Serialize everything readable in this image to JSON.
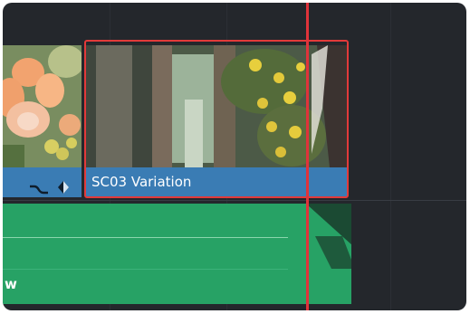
{
  "timeline": {
    "video_clip_left": {
      "icons": [
        "curve-icon",
        "keyframe-diamond-icon"
      ]
    },
    "video_clip_selected": {
      "name": "SC03 Variation",
      "selected": true
    },
    "audio_clip": {
      "name_fragment": "w"
    }
  },
  "colors": {
    "background": "#24272c",
    "video_label": "#3a7cb4",
    "audio_clip": "#27a265",
    "selection": "#e23a3a",
    "playhead": "#e0333a"
  }
}
